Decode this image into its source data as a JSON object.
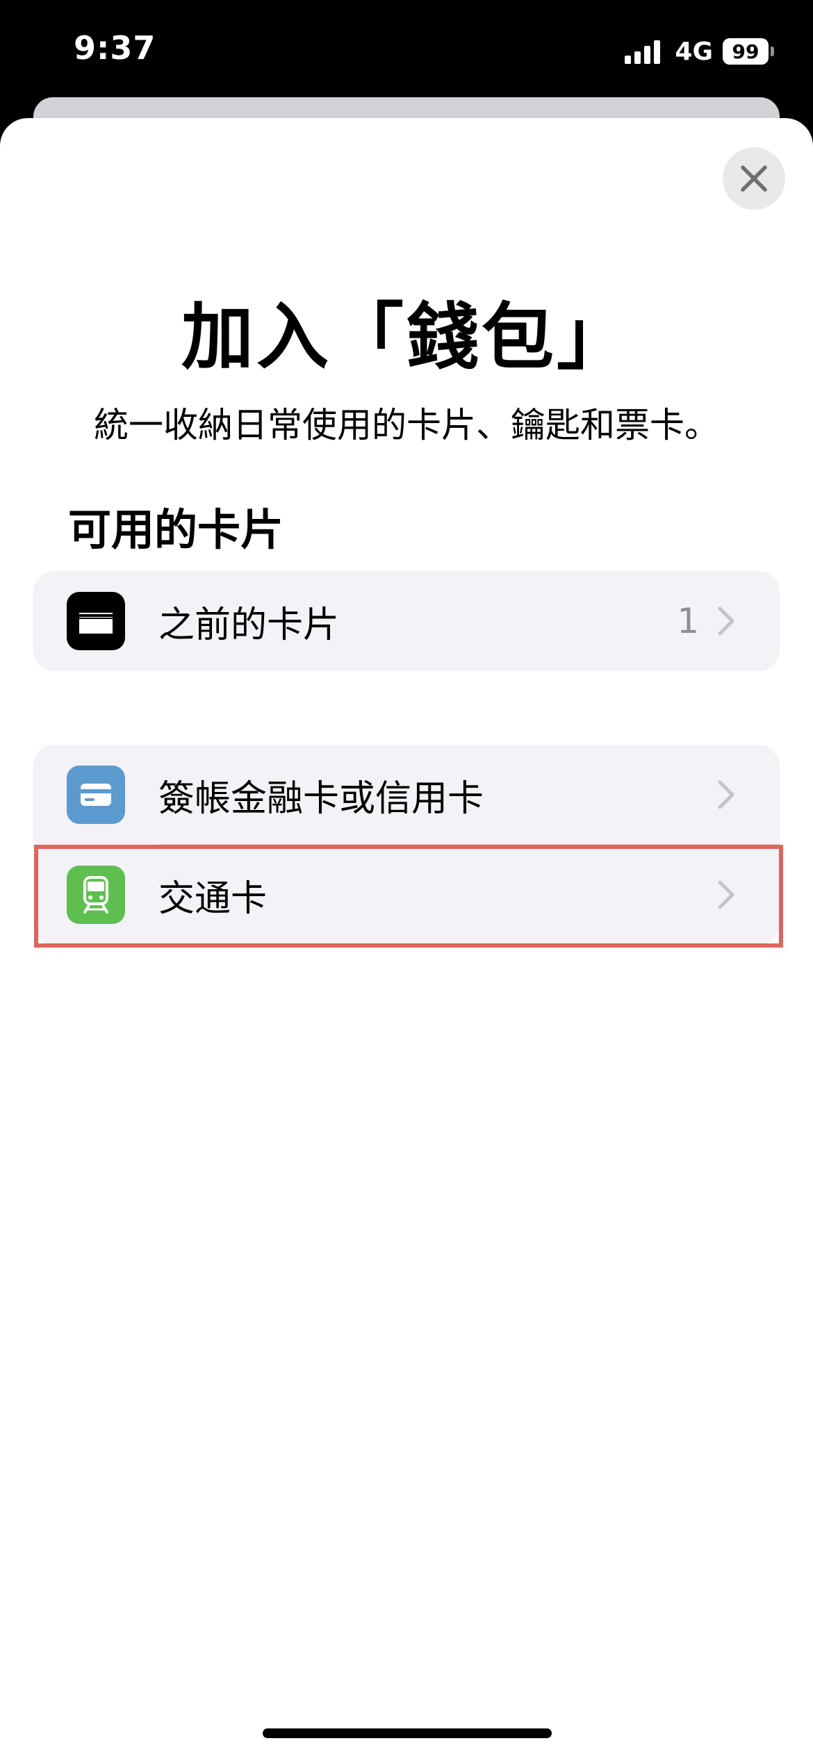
{
  "status_bar": {
    "time": "9:37",
    "network": "4G",
    "battery": "99"
  },
  "page": {
    "title": "加入「錢包」",
    "subtitle": "統一收納日常使用的卡片、鑰匙和票卡。"
  },
  "available_cards": {
    "heading": "可用的卡片",
    "previous": {
      "label": "之前的卡片",
      "count": "1",
      "icon": "wallet-icon",
      "icon_color": "#000000"
    }
  },
  "add_options": [
    {
      "label": "簽帳金融卡或信用卡",
      "icon": "credit-card-icon",
      "icon_color": "#5b9bcf"
    },
    {
      "label": "交通卡",
      "icon": "train-icon",
      "icon_color": "#5fbf4e"
    }
  ],
  "colors": {
    "highlight": "#e0645a",
    "group_background": "#f2f2f7"
  }
}
